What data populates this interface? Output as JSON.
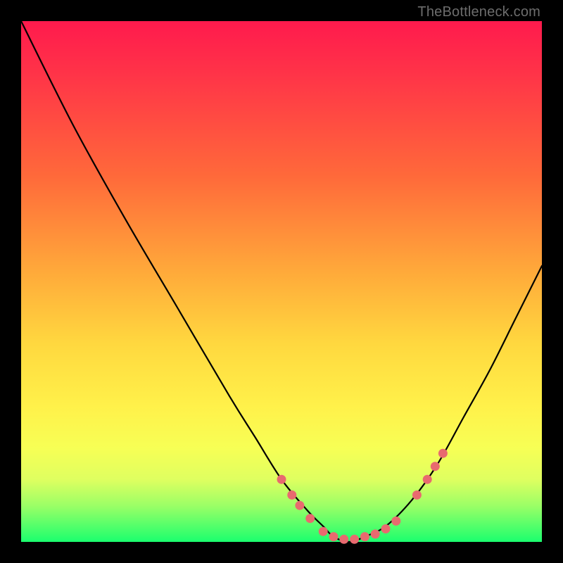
{
  "watermark": "TheBottleneck.com",
  "chart_data": {
    "type": "line",
    "title": "",
    "xlabel": "",
    "ylabel": "",
    "xlim": [
      0,
      100
    ],
    "ylim": [
      0,
      100
    ],
    "grid": false,
    "legend": false,
    "series": [
      {
        "name": "bottleneck-curve",
        "x": [
          0,
          10,
          20,
          30,
          40,
          45,
          50,
          55,
          58,
          60,
          63,
          66,
          70,
          75,
          80,
          85,
          90,
          95,
          100
        ],
        "y": [
          100,
          80,
          62,
          45,
          28,
          20,
          12,
          6,
          3,
          1,
          0,
          1,
          3,
          8,
          15,
          24,
          33,
          43,
          53
        ]
      }
    ],
    "markers": {
      "name": "highlight-dots",
      "color": "#e86a6f",
      "points": [
        {
          "x": 50,
          "y": 12
        },
        {
          "x": 52,
          "y": 9
        },
        {
          "x": 53.5,
          "y": 7
        },
        {
          "x": 55.5,
          "y": 4.5
        },
        {
          "x": 58,
          "y": 2
        },
        {
          "x": 60,
          "y": 1
        },
        {
          "x": 62,
          "y": 0.5
        },
        {
          "x": 64,
          "y": 0.5
        },
        {
          "x": 66,
          "y": 1
        },
        {
          "x": 68,
          "y": 1.5
        },
        {
          "x": 70,
          "y": 2.5
        },
        {
          "x": 72,
          "y": 4
        },
        {
          "x": 76,
          "y": 9
        },
        {
          "x": 78,
          "y": 12
        },
        {
          "x": 79.5,
          "y": 14.5
        },
        {
          "x": 81,
          "y": 17
        }
      ]
    }
  }
}
